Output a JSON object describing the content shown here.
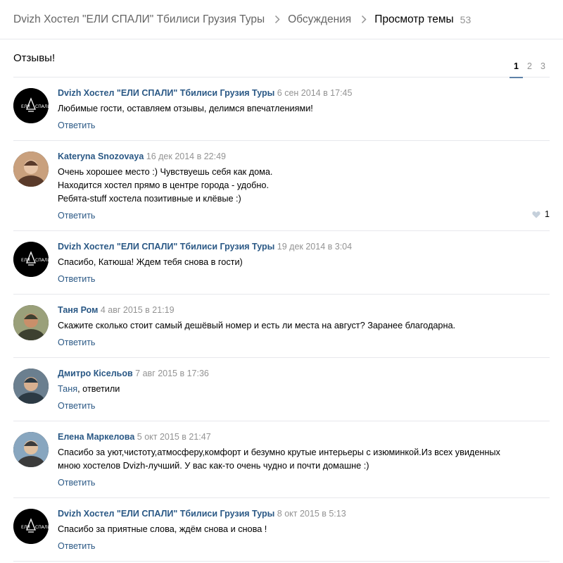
{
  "breadcrumb": {
    "group": "Dvizh Хостел \"ЕЛИ СПАЛИ\" Тбилиси Грузия Туры",
    "discussions": "Обсуждения",
    "current": "Просмотр темы",
    "count": "53"
  },
  "topic": {
    "title": "Отзывы!",
    "pages": [
      "1",
      "2",
      "3"
    ],
    "active_page": "1"
  },
  "colors": {
    "link": "#2a5885",
    "muted": "#939393",
    "border": "#e7e8ec",
    "pager_active": "#5e81a8"
  },
  "posts": [
    {
      "author": "Dvizh Хостел \"ЕЛИ СПАЛИ\" Тбилиси Грузия Туры",
      "date": "6 сен 2014 в 17:45",
      "lines": [
        "Любимые гости, оставляем отзывы, делимся впечатлениями!"
      ],
      "reply": "Ответить",
      "avatar": "hostel-logo-avatar"
    },
    {
      "author": "Kateryna Snozovaya",
      "date": "16 дек 2014 в 22:49",
      "lines": [
        "Очень хорошее место :) Чувствуешь себя как дома.",
        "Находится хостел прямо в центре города - удобно.",
        "Ребята-stuff хостела позитивные и клёвые :)"
      ],
      "reply": "Ответить",
      "likes": "1",
      "avatar": "user-photo-avatar"
    },
    {
      "author": "Dvizh Хостел \"ЕЛИ СПАЛИ\" Тбилиси Грузия Туры",
      "date": "19 дек 2014 в 3:04",
      "lines": [
        "Спасибо, Катюша! Ждем тебя снова в гости)"
      ],
      "reply": "Ответить",
      "avatar": "hostel-logo-avatar"
    },
    {
      "author": "Таня Ром",
      "date": "4 авг 2015 в 21:19",
      "lines": [
        "Скажите сколько стоит самый дешёвый номер и есть ли места на август? Заранее благодарна."
      ],
      "reply": "Ответить",
      "avatar": "user-photo-avatar"
    },
    {
      "author": "Дмитро Кісельов",
      "date": "7 авг 2015 в 17:36",
      "mention": "Таня",
      "lines": [
        ", ответили"
      ],
      "reply": "Ответить",
      "avatar": "user-photo-avatar"
    },
    {
      "author": "Елена Маркелова",
      "date": "5 окт 2015 в 21:47",
      "lines": [
        "Спасибо за уют,чистоту,атмосферу,комфорт и безумно крутые интерьеры с изюминкой.Из всех увиденных",
        "мною хостелов Dvizh-лучший. У вас как-то очень чудно и почти домашне :)"
      ],
      "reply": "Ответить",
      "avatar": "user-photo-avatar"
    },
    {
      "author": "Dvizh Хостел \"ЕЛИ СПАЛИ\" Тбилиси Грузия Туры",
      "date": "8 окт 2015 в 5:13",
      "lines": [
        "Спасибо за приятные слова, ждём снова и снова !"
      ],
      "reply": "Ответить",
      "avatar": "hostel-logo-avatar"
    }
  ]
}
